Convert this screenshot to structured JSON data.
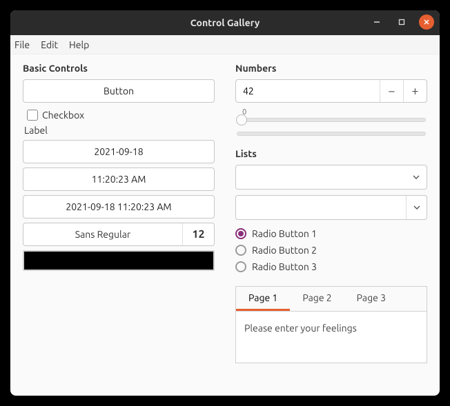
{
  "window": {
    "title": "Control Gallery"
  },
  "menubar": [
    "File",
    "Edit",
    "Help"
  ],
  "left": {
    "title": "Basic Controls",
    "button_label": "Button",
    "checkbox_label": "Checkbox",
    "label_text": "Label",
    "date_value": "2021-09-18",
    "time_value": "11:20:23 AM",
    "datetime_value": "2021-09-18 11:20:23 AM",
    "font_name": "Sans Regular",
    "font_size": "12",
    "color": "#000000"
  },
  "right": {
    "numbers_title": "Numbers",
    "spinner_value": "42",
    "slider_tick": "0",
    "lists_title": "Lists",
    "combo1_value": "",
    "combo2_value": "",
    "radios": [
      "Radio Button 1",
      "Radio Button 2",
      "Radio Button 3"
    ],
    "radio_selected": 0,
    "tabs": [
      "Page 1",
      "Page 2",
      "Page 3"
    ],
    "tab_selected": 0,
    "tab_content_placeholder": "Please enter your feelings"
  }
}
